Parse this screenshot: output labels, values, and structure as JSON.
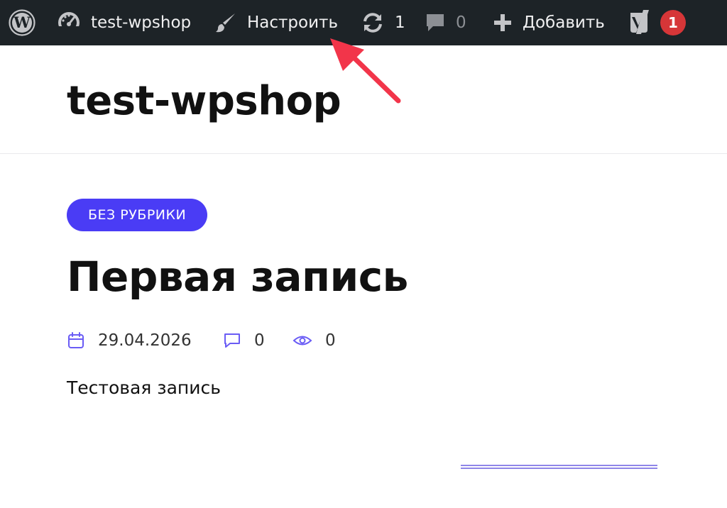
{
  "adminbar": {
    "site_name": "test-wpshop",
    "customize_label": "Настроить",
    "updates_count": "1",
    "comments_count": "0",
    "add_new_label": "Добавить",
    "yoast_notification_count": "1",
    "background_color": "#1d2327",
    "badge_color": "#d63638"
  },
  "header": {
    "site_title": "test-wpshop"
  },
  "post": {
    "category": "БЕЗ РУБРИКИ",
    "category_color": "#4a3cf5",
    "title": "Первая запись",
    "date": "29.04.2026",
    "comments": "0",
    "views": "0",
    "excerpt": "Тестовая запись"
  },
  "annotation": {
    "arrow_color": "#f2354a"
  }
}
